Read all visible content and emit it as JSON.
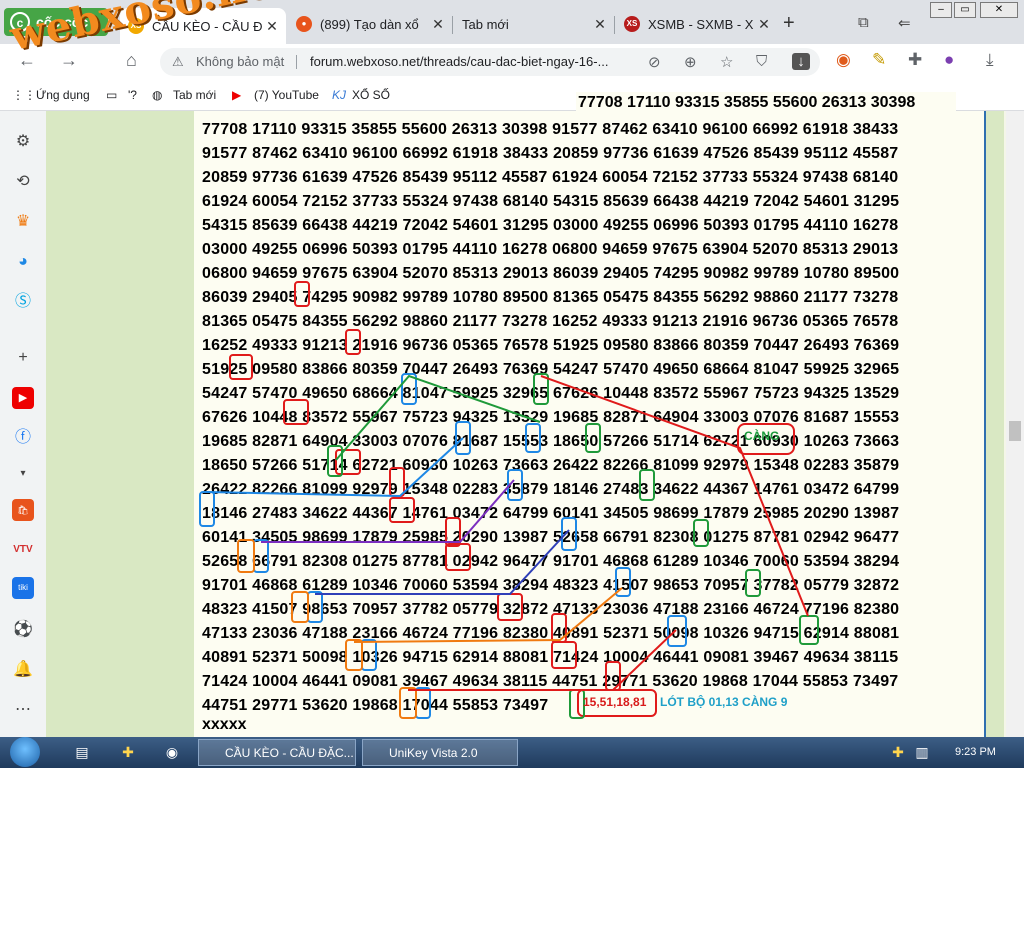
{
  "watermark": "webxoso.net",
  "browser": {
    "brand": "cốc cốc",
    "tabs": [
      {
        "title": "CẦU KÈO - CẦU Đ",
        "icon": "xs-icon",
        "active": true
      },
      {
        "title": "(899) Tạo dàn xổ",
        "icon": "firefox-icon"
      },
      {
        "title": "Tab mới",
        "icon": ""
      },
      {
        "title": "XSMB - SXMB - X",
        "icon": "xs-red-icon"
      }
    ],
    "security": "Không bảo mật",
    "url": "forum.webxoso.net/threads/cau-dac-biet-ngay-16-...",
    "bookmarks": [
      {
        "label": "Ứng dụng"
      },
      {
        "label": "'?"
      },
      {
        "label": "Tab mới"
      },
      {
        "label": "(7) YouTube"
      },
      {
        "label": "XỔ SỐ"
      }
    ]
  },
  "post": {
    "first_line": "77708 17110 93315 35855 55600 26313 30398",
    "rows": [
      "77708 17110 93315 35855 55600 26313 30398 91577 87462 63410 96100 66992 61918 38433",
      "91577 87462 63410 96100 66992 61918 38433 20859 97736 61639 47526 85439 95112 45587",
      "20859 97736 61639 47526 85439 95112 45587 61924 60054 72152 37733 55324 97438 68140",
      "61924 60054 72152 37733 55324 97438 68140 54315 85639 66438 44219 72042 54601 31295",
      "54315 85639 66438 44219 72042 54601 31295 03000 49255 06996 50393 01795 44110 16278",
      "03000 49255 06996 50393 01795 44110 16278 06800 94659 97675 63904 52070 85313 29013",
      "06800 94659 97675 63904 52070 85313 29013 86039 29405 74295 90982 99789 10780 89500",
      "86039 29405 74295 90982 99789 10780 89500 81365 05475 84355 56292 98860 21177 73278",
      "81365 05475 84355 56292 98860 21177 73278 16252 49333 91213 21916 96736 05365 76578",
      "16252 49333 91213 21916 96736 05365 76578 51925 09580 83866 80359 70447 26493 76369",
      "51925 09580 83866 80359 70447 26493 76369 54247 57470 49650 68664 81047 59925 32965",
      "54247 57470 49650 68664 81047 59925 32965 67626 10448 83572 55967 75723 94325 13529",
      "67626 10448 83572 55967 75723 94325 13529 19685 82871 64904 33003 07076 81687 15553",
      "19685 82871 64904 33003 07076 81687 15553 18650 57266 51714 62721 60930 10263 73663",
      "18650 57266 51714 62721 60930 10263 73663 26422 82266 81099 92979 15348 02283 35879",
      "26422 82266 81099 92979 15348 02283 35879 18146 27483 34622 44367 14761 03472 64799",
      "18146 27483 34622 44367 14761 03472 64799 60141 34505 98699 17879 25985 20290 13987",
      "60141 34505 98699 17879 25985 20290 13987 52658 66791 82308 01275 87781 02942 96477",
      "52658 66791 82308 01275 87781 02942 96477 91701 46868 61289 10346 70060 53594 38294",
      "91701 46868 61289 10346 70060 53594 38294 48323 41507 98653 70957 37782 05779 32872",
      "48323 41507 98653 70957 37782 05779 32872 47133 23036 47188 23166 46724 77196 82380",
      "47133 23036 47188 23166 46724 77196 82380 40891 52371 50098 10326 94715 62914 88081",
      "40891 52371 50098 10326 94715 62914 88081 71424 10004 46441 09081 39467 49634 38115",
      "71424 10004 46441 09081 39467 49634 38115 44751 29771 53620 19868 17044 55853 73497",
      "44751 29771 53620 19868 17044 55853 73497"
    ],
    "last": "xxxxx",
    "note_cang": "CÀNG",
    "note_bot": "15,51,18,81",
    "note_lot": "LÓT BỘ 01,13 CÀNG 9",
    "colors": {
      "red": "#e01b1b",
      "green": "#1f9a3a",
      "blue": "#1e88e5",
      "orange": "#f07a10",
      "purple": "#7b2fbf",
      "navy": "#2f3fb8"
    }
  },
  "taskbar": {
    "tasks": [
      {
        "label": "CẦU KÈO - CẦU ĐẶC..."
      },
      {
        "label": "UniKey Vista 2.0"
      }
    ],
    "clock": "9:23 PM"
  }
}
